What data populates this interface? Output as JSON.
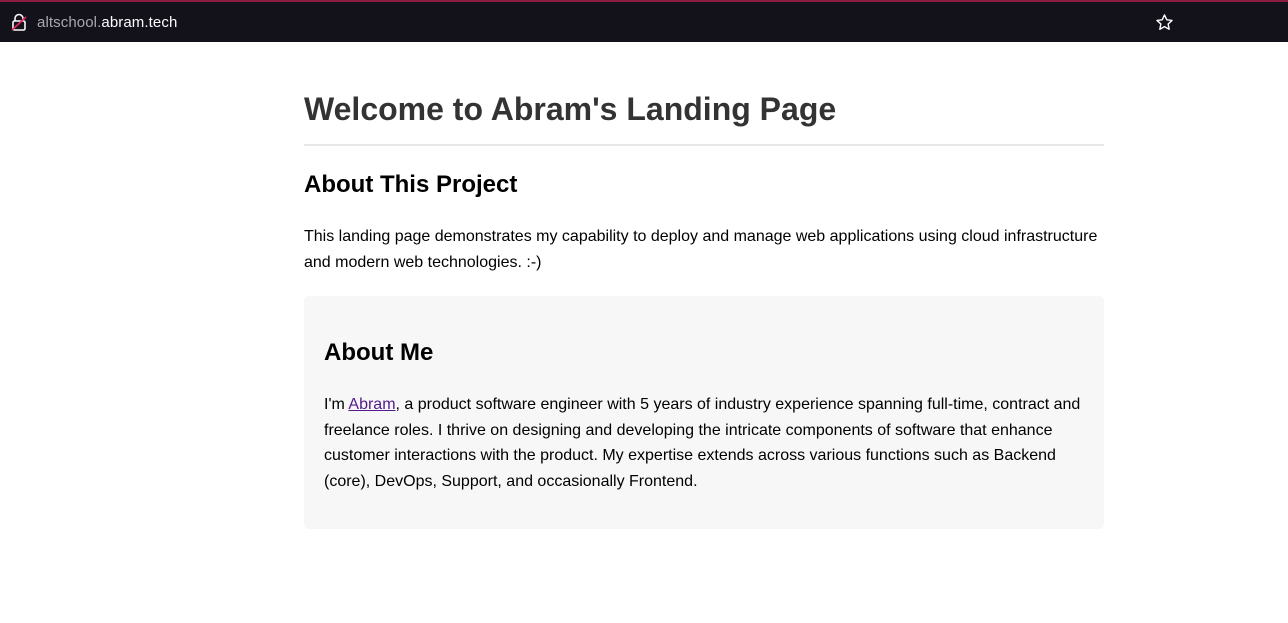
{
  "browser": {
    "url_prefix": "altschool.",
    "url_domain": "abram.tech",
    "icons": {
      "left": "lock-icon",
      "right": "star-icon"
    },
    "accent": "#8c1d40"
  },
  "page": {
    "title": "Welcome to Abram's Landing Page",
    "project": {
      "heading": "About This Project",
      "text": "This landing page demonstrates my capability to deploy and manage web applications using cloud infrastructure and modern web technologies. :-)"
    },
    "about": {
      "heading": "About Me",
      "intro": "I'm ",
      "link_text": "Abram",
      "body": ", a product software engineer with 5 years of industry experience spanning full-time, contract and freelance roles. I thrive on designing and developing the intricate components of software that enhance customer interactions with the product. My expertise extends across various functions such as Backend (core), DevOps, Support, and occasionally Frontend."
    }
  }
}
